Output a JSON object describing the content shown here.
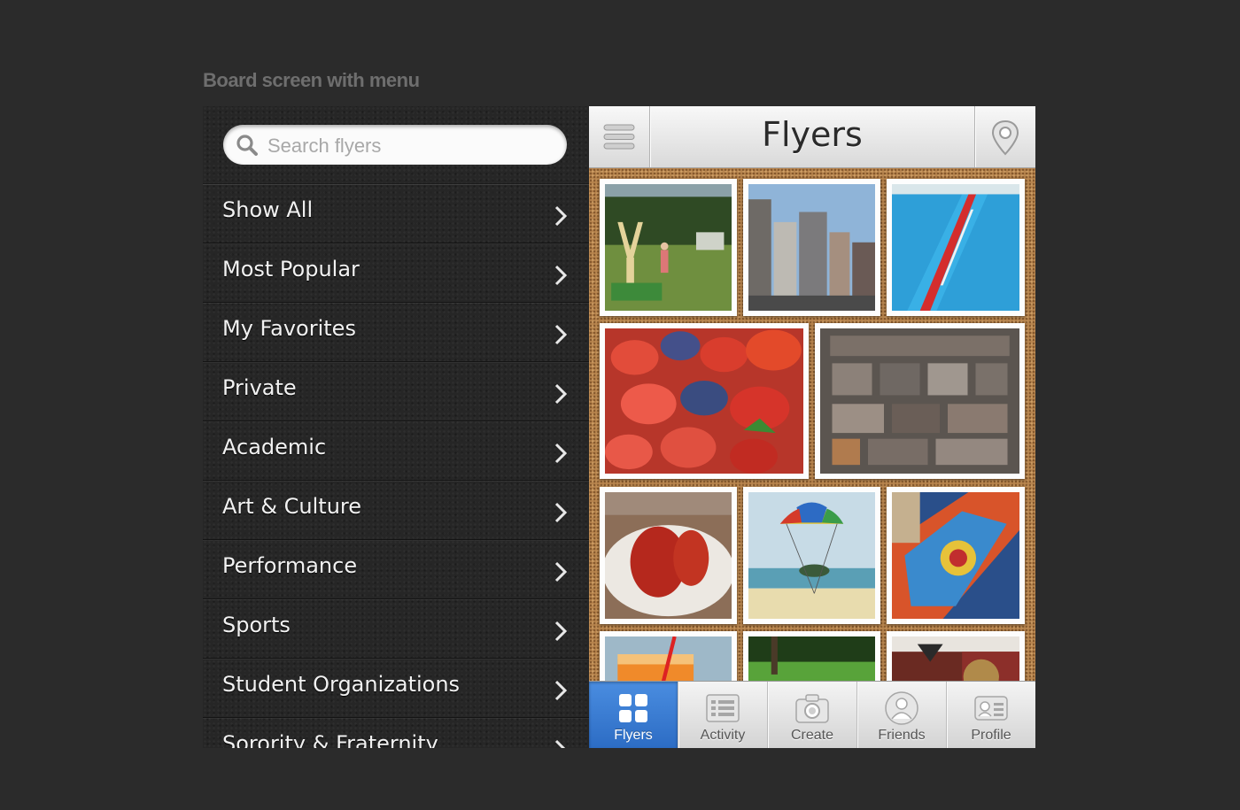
{
  "caption": "Board screen with menu",
  "menu": {
    "search": {
      "placeholder": "Search flyers",
      "value": ""
    },
    "items": [
      {
        "label": "Show All"
      },
      {
        "label": "Most Popular"
      },
      {
        "label": "My Favorites"
      },
      {
        "label": "Private"
      },
      {
        "label": "Academic"
      },
      {
        "label": "Art & Culture"
      },
      {
        "label": "Performance"
      },
      {
        "label": "Sports"
      },
      {
        "label": "Student Organizations"
      },
      {
        "label": "Sorority & Fraternity"
      }
    ]
  },
  "board": {
    "title": "Flyers",
    "left_button_icon": "hamburger-menu-icon",
    "right_button_icon": "location-pin-icon",
    "flyers": [
      {
        "subject": "slingshot-park"
      },
      {
        "subject": "city-buildings"
      },
      {
        "subject": "pool-lane"
      },
      {
        "subject": "berries"
      },
      {
        "subject": "letterpress-type"
      },
      {
        "subject": "lobster-plate"
      },
      {
        "subject": "parasail-beach"
      },
      {
        "subject": "colorful-sand-art"
      },
      {
        "subject": "orange-drink"
      },
      {
        "subject": "green-park"
      },
      {
        "subject": "cafe-interior"
      }
    ]
  },
  "tabbar": {
    "active": "Flyers",
    "tabs": [
      {
        "label": "Flyers",
        "icon": "grid-icon"
      },
      {
        "label": "Activity",
        "icon": "list-icon"
      },
      {
        "label": "Create",
        "icon": "camera-icon"
      },
      {
        "label": "Friends",
        "icon": "person-icon"
      },
      {
        "label": "Profile",
        "icon": "id-card-icon"
      }
    ]
  },
  "colors": {
    "background": "#2b2b2b",
    "menu_background": "#262626",
    "cork": "#b9864f",
    "active_tab": "#3a7dd6",
    "caption": "#6e6e6e"
  }
}
